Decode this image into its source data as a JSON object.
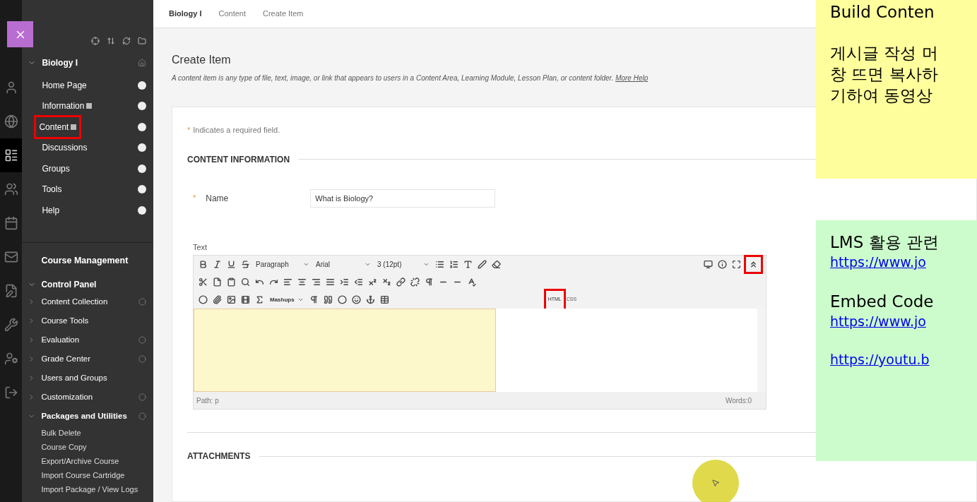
{
  "breadcrumbs": [
    {
      "label": "Biology I",
      "current": true
    },
    {
      "label": "Content",
      "current": false
    },
    {
      "label": "Create Item",
      "current": false
    }
  ],
  "rail": [
    {
      "selected": false
    },
    {
      "selected": false
    },
    {
      "selected": true
    },
    {
      "selected": false
    },
    {
      "selected": false
    },
    {
      "selected": false
    },
    {
      "selected": false
    },
    {
      "selected": false
    },
    {
      "selected": false
    },
    {
      "selected": false
    }
  ],
  "course_menu": {
    "title": "Biology I",
    "items": [
      {
        "label": "Home Page",
        "has_badge": false,
        "highlighted": false
      },
      {
        "label": "Information",
        "has_badge": true,
        "highlighted": false
      },
      {
        "label": "Content",
        "has_badge": true,
        "highlighted": true
      },
      {
        "label": "Discussions",
        "has_badge": false,
        "highlighted": false
      },
      {
        "label": "Groups",
        "has_badge": false,
        "highlighted": false
      },
      {
        "label": "Tools",
        "has_badge": false,
        "highlighted": false
      },
      {
        "label": "Help",
        "has_badge": false,
        "highlighted": false
      }
    ]
  },
  "course_management": {
    "title": "Course Management",
    "control_panel": "Control Panel",
    "items": [
      {
        "label": "Content Collection",
        "expanded": false,
        "has_action": true
      },
      {
        "label": "Course Tools",
        "expanded": false,
        "has_action": false
      },
      {
        "label": "Evaluation",
        "expanded": false,
        "has_action": true
      },
      {
        "label": "Grade Center",
        "expanded": false,
        "has_action": true
      },
      {
        "label": "Users and Groups",
        "expanded": false,
        "has_action": false
      },
      {
        "label": "Customization",
        "expanded": false,
        "has_action": true
      },
      {
        "label": "Packages and Utilities",
        "expanded": true,
        "has_action": true,
        "children": [
          "Bulk Delete",
          "Course Copy",
          "Export/Archive Course",
          "Import Course Cartridge",
          "Import Package / View Logs"
        ]
      }
    ]
  },
  "page": {
    "title": "Create Item",
    "description": "A content item is any type of file, text, image, or link that appears to users in a Content Area, Learning Module, Lesson Plan, or content folder.",
    "help_link": "More Help",
    "required_mark": "*",
    "required_note": "Indicates a required field.",
    "section": "CONTENT INFORMATION",
    "name_label": "Name",
    "name_value": "What is Biology?",
    "text_label": "Text",
    "editor": {
      "selects": [
        "Paragraph",
        "Arial",
        "3 (12pt)"
      ],
      "mashups": "Mashups",
      "html_label": "HTML",
      "html_highlighted": true,
      "css_label": "CSS",
      "collapse_highlighted": true,
      "path": "Path: p",
      "words": "Words:0"
    },
    "attachments": "ATTACHMENTS"
  },
  "notes": [
    {
      "kind": "yellow",
      "lines": [
        {
          "kind": "text",
          "text": "Build Conten"
        },
        {
          "kind": "gap"
        },
        {
          "kind": "text",
          "text": "게시글 작성 머"
        },
        {
          "kind": "text",
          "text": "창 뜨면 복사하"
        },
        {
          "kind": "text",
          "text": "기하여 동영상"
        }
      ]
    },
    {
      "kind": "green",
      "lines": [
        {
          "kind": "text",
          "text": "LMS 활용 관련"
        },
        {
          "kind": "link",
          "text": "https://www.jo"
        },
        {
          "kind": "gap"
        },
        {
          "kind": "text",
          "text": "Embed Code"
        },
        {
          "kind": "link",
          "text": "https://www.jo"
        },
        {
          "kind": "gap"
        },
        {
          "kind": "link",
          "text": "https://youtu.b"
        }
      ]
    }
  ]
}
